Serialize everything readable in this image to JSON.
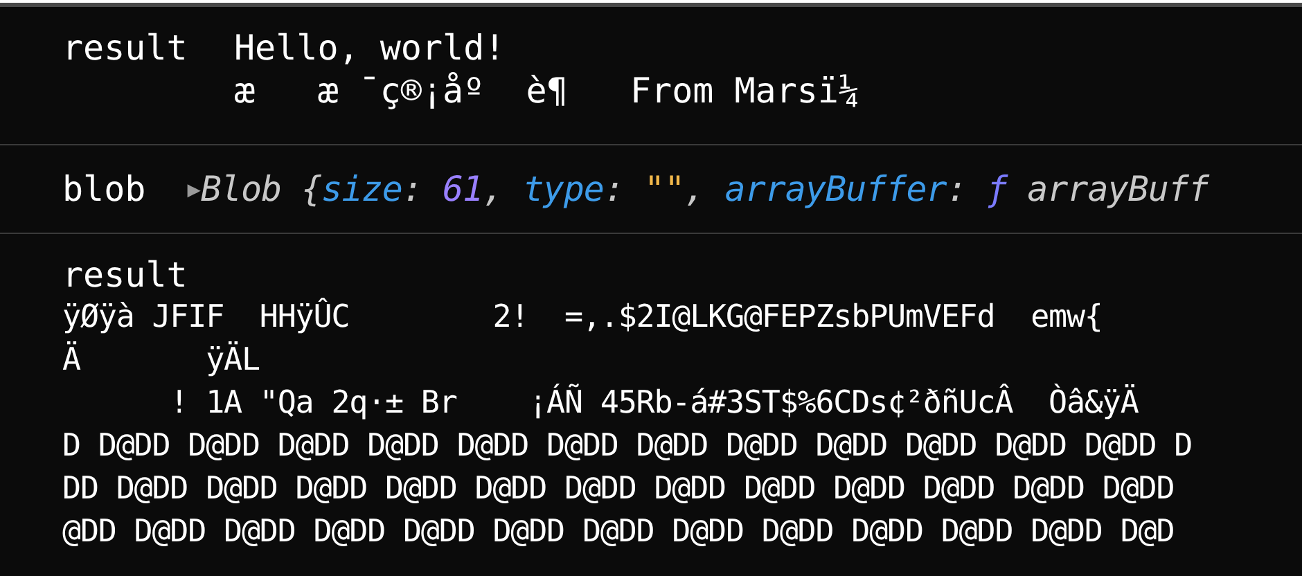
{
  "entries": [
    {
      "kind": "inline",
      "label": "result",
      "lines": [
        "Hello, world!",
        "æ   æ ¯ç®¡åº  è¶   From Marsï¼"
      ]
    },
    {
      "kind": "object",
      "label": "blob",
      "expanded": false,
      "arrow": "▶",
      "tokens": [
        {
          "kind": "plain",
          "text": "Blob {"
        },
        {
          "kind": "key",
          "text": "size"
        },
        {
          "kind": "plain",
          "text": ": "
        },
        {
          "kind": "number",
          "text": "61"
        },
        {
          "kind": "plain",
          "text": ", "
        },
        {
          "kind": "key",
          "text": "type"
        },
        {
          "kind": "plain",
          "text": ": "
        },
        {
          "kind": "string",
          "text": "\"\""
        },
        {
          "kind": "plain",
          "text": ", "
        },
        {
          "kind": "key",
          "text": "arrayBuffer"
        },
        {
          "kind": "plain",
          "text": ": "
        },
        {
          "kind": "function",
          "text": "ƒ"
        },
        {
          "kind": "plain",
          "text": " arrayBuff"
        }
      ]
    },
    {
      "kind": "block",
      "label": "result",
      "lines": [
        "ÿØÿà JFIF  HHÿÛC        2!  =,.$2I@LKG@FEPZsbPUmVEFd  emw{",
        "Ä       ÿÄL",
        "      ! 1A \"Qa 2q·± Br    ¡ÁÑ 45Rb-á#3ST$%6CDs¢²ðñUcÂ  Òâ&ÿÄ",
        "D D@DD D@DD D@DD D@DD D@DD D@DD D@DD D@DD D@DD D@DD D@DD D@DD D",
        "DD D@DD D@DD D@DD D@DD D@DD D@DD D@DD D@DD D@DD D@DD D@DD D@DD",
        "@DD D@DD D@DD D@DD D@DD D@DD D@DD D@DD D@DD D@DD D@DD D@DD D@D"
      ]
    }
  ]
}
